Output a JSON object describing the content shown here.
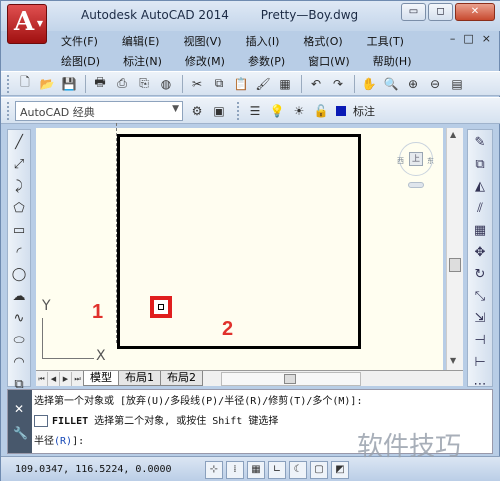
{
  "window": {
    "app_name": "Autodesk AutoCAD 2014",
    "file_name": "Pretty—Boy.dwg",
    "controls": {
      "minimize": "▭",
      "restore": "◻",
      "close": "✕"
    }
  },
  "menu": {
    "row1": [
      "文件(F)",
      "编辑(E)",
      "视图(V)",
      "插入(I)",
      "格式(O)",
      "工具(T)"
    ],
    "row2": [
      "绘图(D)",
      "标注(N)",
      "修改(M)",
      "参数(P)",
      "窗口(W)",
      "帮助(H)"
    ],
    "mdi_controls": [
      "–",
      "□",
      "×"
    ]
  },
  "toolbar": {
    "workspace": "AutoCAD 经典",
    "layer": "标注"
  },
  "canvas": {
    "ucs_y": "Y",
    "ucs_x": "X",
    "marker_1": "1",
    "marker_2": "2",
    "viewcube": {
      "face": "上",
      "west": "西",
      "east": "东"
    }
  },
  "tabs": [
    "模型",
    "布局1",
    "布局2"
  ],
  "command": {
    "line1": "选择第一个对象或 [放弃(U)/多段线(P)/半径(R)/修剪(T)/多个(M)]:",
    "line2_prefix": "FILLET",
    "line2_rest": "选择第二个对象, 或按住 Shift 键选择",
    "line3_prefix": "半径",
    "line3_option": "(R)",
    "line3_suffix": "]:"
  },
  "status": {
    "coords": "109.0347, 116.5224, 0.0000"
  },
  "watermark": "软件技巧",
  "colors": {
    "accent_red": "#e01e1e",
    "layer_blue": "#0a1ab5"
  }
}
